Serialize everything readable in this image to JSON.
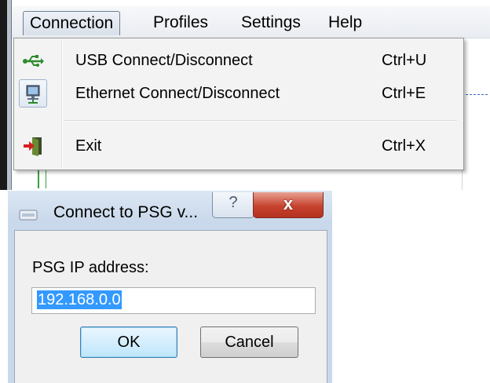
{
  "menubar": {
    "items": [
      {
        "label": "Connection"
      },
      {
        "label": "Profiles"
      },
      {
        "label": "Settings"
      },
      {
        "label": "Help"
      }
    ]
  },
  "connection_menu": {
    "items": [
      {
        "label": "USB Connect/Disconnect",
        "shortcut": "Ctrl+U",
        "icon": "usb-icon"
      },
      {
        "label": "Ethernet Connect/Disconnect",
        "shortcut": "Ctrl+E",
        "icon": "network-computer-icon"
      },
      {
        "label": "Exit",
        "shortcut": "Ctrl+X",
        "icon": "exit-door-icon"
      }
    ]
  },
  "dialog": {
    "title": "Connect to PSG v...",
    "help_glyph": "?",
    "close_glyph": "x",
    "ip_label": "PSG IP address:",
    "ip_value": "192.168.0.0",
    "ok_label": "OK",
    "cancel_label": "Cancel"
  },
  "colors": {
    "selection": "#3399ff",
    "close_button": "#c7432f",
    "ok_border": "#3c7fb1"
  }
}
